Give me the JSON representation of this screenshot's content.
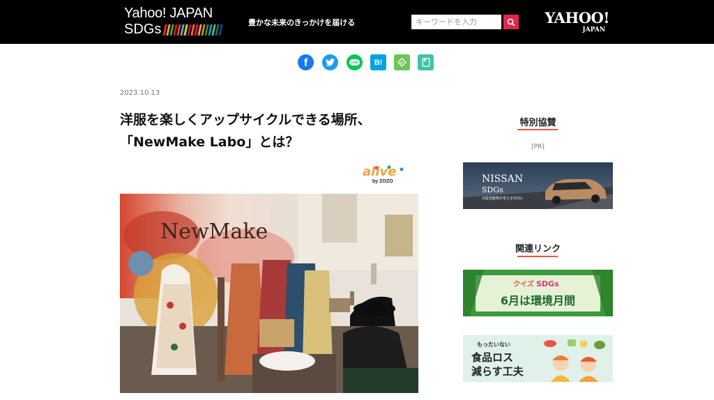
{
  "header": {
    "logo_line1": "Yahoo! JAPAN",
    "logo_line2": "SDGs",
    "tagline": "豊かな未来のきっかけを届ける",
    "search_placeholder": "キーワードを入力",
    "yahoo_main": "YAHOO!",
    "yahoo_sub": "JAPAN",
    "sdg_colors": [
      "#e5243b",
      "#dda63a",
      "#4c9f38",
      "#c5192d",
      "#ff3a21",
      "#26bde2",
      "#fcc30b",
      "#a21942",
      "#fd6925",
      "#dd1367",
      "#fd9d24",
      "#bf8b2e",
      "#3f7e44",
      "#0a97d9",
      "#56c02b",
      "#00689d",
      "#19486a"
    ]
  },
  "share": [
    {
      "name": "facebook-icon",
      "glyph": "f",
      "color": "#1877f2"
    },
    {
      "name": "twitter-icon",
      "glyph": "",
      "color": "#1d9bf0"
    },
    {
      "name": "line-icon",
      "glyph": "LINE",
      "color": "#06c755"
    },
    {
      "name": "hatena-bookmark-icon",
      "glyph": "B!",
      "color": "#00a4de"
    },
    {
      "name": "feedly-icon",
      "glyph": "",
      "color": "#6cc655"
    },
    {
      "name": "pocket-icon",
      "glyph": "",
      "color": "#40c3a6"
    }
  ],
  "article": {
    "date": "2023.10.13",
    "title_line1": "洋服を楽しくアップサイクルできる場所、",
    "title_line2": "「NewMake Labo」とは？",
    "partner_logo": "alive",
    "partner_by": "by ZOZO",
    "photo_sign": "NewMake"
  },
  "sidebar": {
    "sponsor_heading": "特別協賛",
    "pr_label": "[PR]",
    "nissan_title": "NISSAN",
    "nissan_sub": "SDGs",
    "nissan_caption": "日産自動車が考えるSDGs",
    "related_heading": "関連リンク",
    "quiz_top_a": "クイズ",
    "quiz_top_b": "SDGs",
    "quiz_main": "6月は環境月間",
    "food_top": "もったいない",
    "food_line1": "食品ロス",
    "food_line2": "減らす工夫",
    "accent_color": "#e8553f"
  }
}
